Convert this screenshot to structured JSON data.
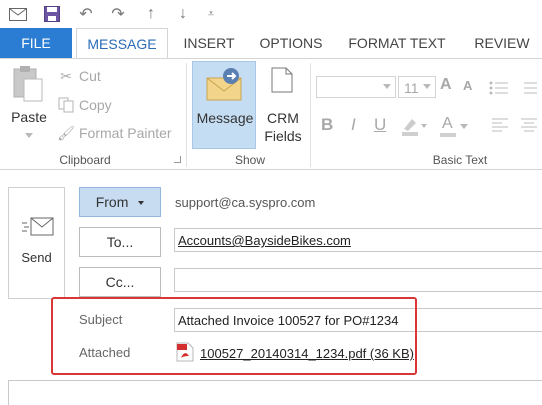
{
  "tabs": {
    "file": "FILE",
    "message": "MESSAGE",
    "insert": "INSERT",
    "options": "OPTIONS",
    "format_text": "FORMAT TEXT",
    "review": "REVIEW"
  },
  "clipboard": {
    "paste": "Paste",
    "cut": "Cut",
    "copy": "Copy",
    "format_painter": "Format Painter",
    "group_label": "Clipboard"
  },
  "show": {
    "message": "Message",
    "crm_line1": "CRM",
    "crm_line2": "Fields",
    "group_label": "Show"
  },
  "basic_text": {
    "font_size": "11",
    "group_label": "Basic Text",
    "bold": "B",
    "italic": "I",
    "underline": "U",
    "grow": "A",
    "shrink": "A"
  },
  "compose": {
    "send": "Send",
    "from_button": "From",
    "from_value": "support@ca.syspro.com",
    "to_button": "To...",
    "to_value": "Accounts@BaysideBikes.com",
    "cc_button": "Cc...",
    "cc_value": "",
    "subject_label": "Subject",
    "subject_value": "Attached Invoice 100527 for PO#1234",
    "attached_label": "Attached",
    "attachment_name": "100527_20140314_1234.pdf (36 KB)"
  },
  "colors": {
    "accent": "#2b7cd3",
    "highlight_border": "#d93737",
    "selected_button": "#c5ddf3"
  }
}
